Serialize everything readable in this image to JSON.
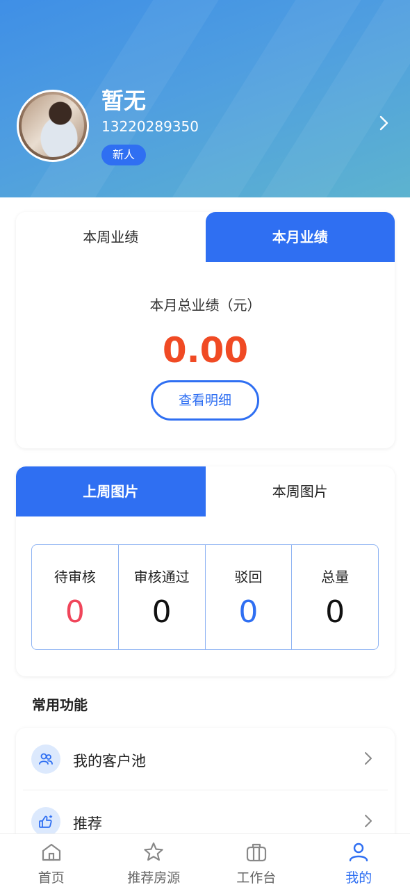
{
  "profile": {
    "name": "暂无",
    "phone": "13220289350",
    "badge": "新人"
  },
  "performance": {
    "tabs": [
      "本周业绩",
      "本月业绩"
    ],
    "active_tab": "本月业绩",
    "subtitle": "本月总业绩（元）",
    "value": "0.00",
    "detail_button": "查看明细"
  },
  "pictures": {
    "tabs": [
      "上周图片",
      "本周图片"
    ],
    "active_tab": "上周图片",
    "stats": [
      {
        "label": "待审核",
        "value": "0",
        "color": "#f0455a"
      },
      {
        "label": "审核通过",
        "value": "0",
        "color": "#111111"
      },
      {
        "label": "驳回",
        "value": "0",
        "color": "#2f6ff2"
      },
      {
        "label": "总量",
        "value": "0",
        "color": "#111111"
      }
    ]
  },
  "functions": {
    "title": "常用功能",
    "items": [
      {
        "label": "我的客户池",
        "icon": "users-icon"
      },
      {
        "label": "推荐",
        "icon": "thumbs-up-icon"
      }
    ]
  },
  "nav": {
    "items": [
      {
        "label": "首页",
        "icon": "home-icon"
      },
      {
        "label": "推荐房源",
        "icon": "star-icon"
      },
      {
        "label": "工作台",
        "icon": "briefcase-icon"
      },
      {
        "label": "我的",
        "icon": "user-icon"
      }
    ],
    "active": "我的"
  },
  "colors": {
    "accent": "#2f6ff2",
    "value_red": "#f04a24"
  }
}
